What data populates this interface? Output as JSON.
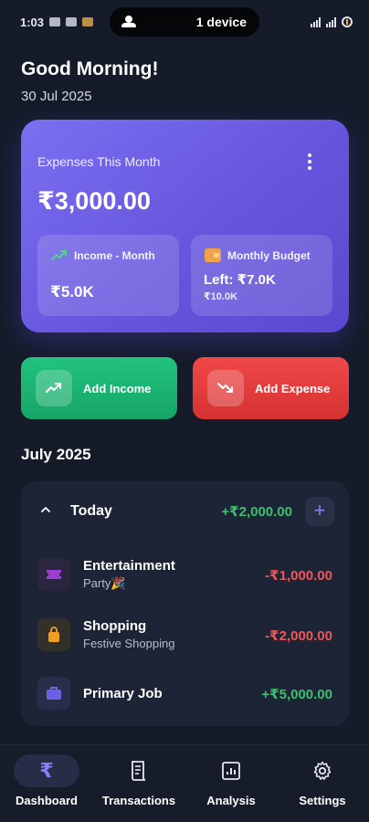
{
  "status_bar": {
    "time": "1:03",
    "pill_label": "1 device"
  },
  "greeting": "Good Morning!",
  "date": "30 Jul 2025",
  "expenses_card": {
    "title": "Expenses This Month",
    "amount": "₹3,000.00",
    "income": {
      "label": "Income - Month",
      "value": "₹5.0K"
    },
    "budget": {
      "label": "Monthly Budget",
      "left": "Left: ₹7.0K",
      "total": "₹10.0K"
    }
  },
  "actions": {
    "add_income": "Add Income",
    "add_expense": "Add Expense"
  },
  "month_title": "July 2025",
  "today": {
    "label": "Today",
    "total": "+₹2,000.00",
    "add_symbol": "+"
  },
  "transactions": [
    {
      "name": "Entertainment",
      "sub": "Party🎉",
      "amount": "-₹1,000.00",
      "icon": "ticket-icon",
      "icon_color": "#9b3fd1"
    },
    {
      "name": "Shopping",
      "sub": "Festive Shopping",
      "amount": "-₹2,000.00",
      "icon": "shopping-bag-icon",
      "icon_color": "#f0a020"
    },
    {
      "name": "Primary Job",
      "sub": "",
      "amount": "+₹5,000.00",
      "icon": "briefcase-icon",
      "icon_color": "#6b5fe8"
    }
  ],
  "nav": {
    "items": [
      {
        "label": "Dashboard",
        "icon": "rupee-icon",
        "active": true
      },
      {
        "label": "Transactions",
        "icon": "receipt-icon",
        "active": false
      },
      {
        "label": "Analysis",
        "icon": "chart-icon",
        "active": false
      },
      {
        "label": "Settings",
        "icon": "gear-icon",
        "active": false
      }
    ]
  },
  "colors": {
    "background": "#151b29",
    "card_accent": "#6656de",
    "income_green": "#3bc16e",
    "expense_red": "#f05656"
  }
}
